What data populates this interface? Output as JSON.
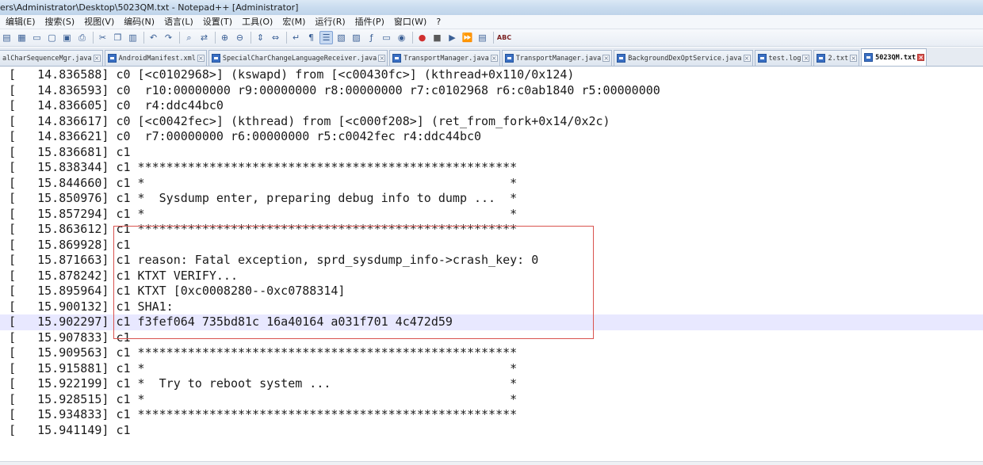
{
  "window": {
    "title": "ers\\Administrator\\Desktop\\5023QM.txt - Notepad++ [Administrator]"
  },
  "menu": [
    "编辑(E)",
    "搜索(S)",
    "视图(V)",
    "编码(N)",
    "语言(L)",
    "设置(T)",
    "工具(O)",
    "宏(M)",
    "运行(R)",
    "插件(P)",
    "窗口(W)",
    "?"
  ],
  "toolbar": {
    "icons": [
      "save-icon",
      "save-all-icon",
      "open-icon",
      "close-icon",
      "close-all-icon",
      "print-icon",
      "sep",
      "cut-icon",
      "copy-icon",
      "paste-icon",
      "sep",
      "undo-icon",
      "redo-icon",
      "sep",
      "find-icon",
      "replace-icon",
      "sep",
      "zoom-in-icon",
      "zoom-out-icon",
      "sep",
      "sync-vertical-icon",
      "sync-horizontal-icon",
      "sep",
      "word-wrap-icon",
      "show-all-chars-icon",
      "indent-guide-icon",
      "udl-icon",
      "doc-map-icon",
      "function-list-icon",
      "folder-workspace-icon",
      "monitoring-icon",
      "sep",
      "record-macro-icon",
      "stop-record-icon",
      "play-macro-icon",
      "run-macro-multiple-icon",
      "save-macro-icon",
      "sep",
      "spell-check-icon"
    ],
    "glyphs": {
      "save-icon": "▤",
      "save-all-icon": "▦",
      "open-icon": "▭",
      "close-icon": "▢",
      "close-all-icon": "▣",
      "print-icon": "⎙",
      "cut-icon": "✂",
      "copy-icon": "❐",
      "paste-icon": "▥",
      "undo-icon": "↶",
      "redo-icon": "↷",
      "find-icon": "⌕",
      "replace-icon": "⇄",
      "zoom-in-icon": "⊕",
      "zoom-out-icon": "⊖",
      "sync-vertical-icon": "⇕",
      "sync-horizontal-icon": "⇔",
      "word-wrap-icon": "↵",
      "show-all-chars-icon": "¶",
      "indent-guide-icon": "☰",
      "udl-icon": "▧",
      "doc-map-icon": "▨",
      "function-list-icon": "ƒ",
      "folder-workspace-icon": "▭",
      "monitoring-icon": "◉",
      "record-macro-icon": "●",
      "stop-record-icon": "■",
      "play-macro-icon": "▶",
      "run-macro-multiple-icon": "⏩",
      "save-macro-icon": "▤",
      "spell-check-icon": "ABC"
    },
    "colors": {
      "record-macro-icon": "#d0302f",
      "stop-record-icon": "#5a5a5a",
      "spell-check-icon": "#7a1f1f",
      "default": "#3a5f95"
    },
    "active": "indent-guide-icon"
  },
  "tabs": [
    {
      "label": "alCharSequenceMgr.java",
      "active": false,
      "first": true
    },
    {
      "label": "AndroidManifest.xml",
      "active": false
    },
    {
      "label": "SpecialCharChangeLanguageReceiver.java",
      "active": false
    },
    {
      "label": "TransportManager.java",
      "active": false
    },
    {
      "label": "TransportManager.java",
      "active": false
    },
    {
      "label": "BackgroundDexOptService.java",
      "active": false
    },
    {
      "label": "test.log",
      "active": false
    },
    {
      "label": "2.txt",
      "active": false
    },
    {
      "label": "5023QM.txt",
      "active": true
    }
  ],
  "editor": {
    "current_line_index": 16,
    "lines": [
      "[   14.836588] c0 [<c0102968>] (kswapd) from [<c00430fc>] (kthread+0x110/0x124)",
      "[   14.836593] c0  r10:00000000 r9:00000000 r8:00000000 r7:c0102968 r6:c0ab1840 r5:00000000",
      "[   14.836605] c0  r4:ddc44bc0",
      "[   14.836617] c0 [<c0042fec>] (kthread) from [<c000f208>] (ret_from_fork+0x14/0x2c)",
      "[   14.836621] c0  r7:00000000 r6:00000000 r5:c0042fec r4:ddc44bc0",
      "[   15.836681] c1",
      "[   15.838344] c1 *****************************************************",
      "[   15.844660] c1 *                                                   *",
      "[   15.850976] c1 *  Sysdump enter, preparing debug info to dump ...  *",
      "[   15.857294] c1 *                                                   *",
      "[   15.863612] c1 *****************************************************",
      "[   15.869928] c1",
      "[   15.871663] c1 reason: Fatal exception, sprd_sysdump_info->crash_key: 0",
      "[   15.878242] c1 KTXT VERIFY...",
      "[   15.895964] c1 KTXT [0xc0008280--0xc0788314]",
      "[   15.900132] c1 SHA1:",
      "[   15.902297] c1 f3fef064 735bd81c 16a40164 a031f701 4c472d59",
      "[   15.907833] c1",
      "[   15.909563] c1 *****************************************************",
      "[   15.915881] c1 *                                                   *",
      "[   15.922199] c1 *  Try to reboot system ...                         *",
      "[   15.928515] c1 *                                                   *",
      "[   15.934833] c1 *****************************************************",
      "[   15.941149] c1"
    ]
  },
  "annotation": {
    "color": "#d9534f"
  }
}
